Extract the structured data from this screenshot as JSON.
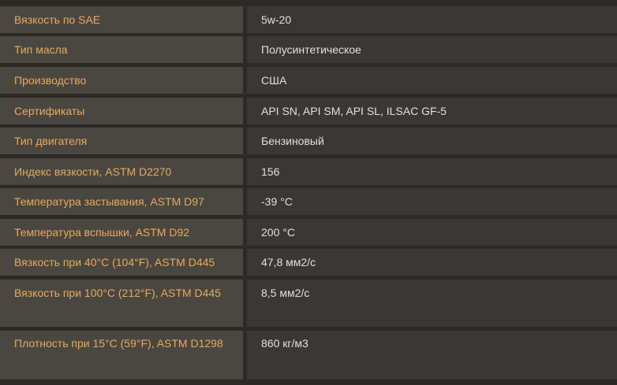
{
  "specs": {
    "rows": [
      {
        "label": "Вязкость по SAE",
        "value": "5w-20"
      },
      {
        "label": "Тип масла",
        "value": "Полусинтетическое"
      },
      {
        "label": "Производство",
        "value": "США"
      },
      {
        "label": "Сертификаты",
        "value": "API SN, API SM, API SL, ILSAC GF-5"
      },
      {
        "label": "Тип двигателя",
        "value": "Бензиновый"
      },
      {
        "label": "Индекс вязкости, ASTM D2270",
        "value": "156"
      },
      {
        "label": "Температура застывания, ASTM D97",
        "value": "-39 °С"
      },
      {
        "label": "Температура вспышки, ASTM D92",
        "value": "200 °С"
      },
      {
        "label": "Вязкость при 40°C (104°F), ASTM D445",
        "value": "47,8 мм2/с"
      },
      {
        "label": "Вязкость при 100°C (212°F), ASTM D445",
        "value": "8,5 мм2/с"
      },
      {
        "label": "Плотность при 15°C (59°F), ASTM D1298",
        "value": "860 кг/м3"
      }
    ]
  },
  "colors": {
    "label_bg": "#4a4741",
    "value_bg": "#3a3834",
    "label_text": "#e6aa5c",
    "value_text": "#e2e0dc",
    "page_bg": "#2b2a27"
  }
}
